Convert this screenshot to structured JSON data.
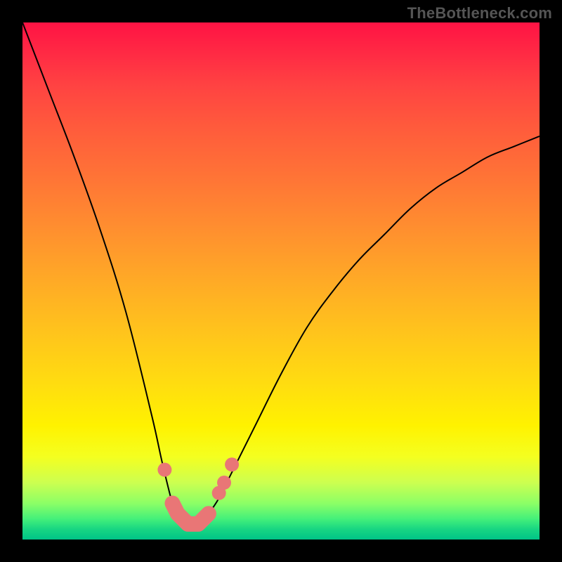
{
  "watermark": "TheBottleneck.com",
  "colors": {
    "dot": "#e97676",
    "line": "#000000"
  },
  "chart_data": {
    "type": "line",
    "title": "",
    "xlabel": "",
    "ylabel": "",
    "xlim": [
      0,
      100
    ],
    "ylim": [
      0,
      100
    ],
    "grid": false,
    "legend": false,
    "x": [
      0,
      5,
      10,
      15,
      20,
      25,
      27,
      29,
      30,
      31,
      32,
      33,
      34,
      35,
      36,
      38,
      40,
      45,
      50,
      55,
      60,
      65,
      70,
      75,
      80,
      85,
      90,
      95,
      100
    ],
    "y": [
      100,
      87,
      74,
      60,
      44,
      24,
      15,
      7,
      5,
      4,
      3,
      3,
      3,
      4,
      5,
      8,
      12,
      22,
      32,
      41,
      48,
      54,
      59,
      64,
      68,
      71,
      74,
      76,
      78
    ],
    "markers": {
      "thick_segment_x": [
        29,
        30,
        31,
        32,
        33,
        34,
        35,
        36
      ],
      "thick_segment_y": [
        7,
        5,
        4,
        3,
        3,
        3,
        4,
        5
      ],
      "dots": [
        {
          "x": 27.5,
          "y": 13.5
        },
        {
          "x": 38.0,
          "y": 9.0
        },
        {
          "x": 39.0,
          "y": 11.0
        },
        {
          "x": 40.5,
          "y": 14.5
        }
      ]
    },
    "notes": "Values estimated from pixel positions; unlabeled axes."
  }
}
